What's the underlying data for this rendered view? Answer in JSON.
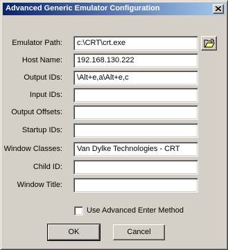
{
  "window": {
    "title": "Advanced Generic Emulator Configuration",
    "close_icon": "close-icon"
  },
  "form": {
    "fields": [
      {
        "label": "Emulator Path:",
        "value": "c:\\CRT\\crt.exe"
      },
      {
        "label": "Host Name:",
        "value": "192.168.130.222"
      },
      {
        "label": "Output IDs:",
        "value": "\\Alt+e,a\\Alt+e,c"
      },
      {
        "label": "Input IDs:",
        "value": ""
      },
      {
        "label": "Output Offsets:",
        "value": ""
      },
      {
        "label": "Startup IDs:",
        "value": ""
      },
      {
        "label": "Window Classes:",
        "value": "Van Dylke Technologies - CRT"
      },
      {
        "label": "Child ID:",
        "value": ""
      },
      {
        "label": "Window Title:",
        "value": ""
      }
    ],
    "browse_icon": "folder-open-icon",
    "advanced_enter_label": "Use Advanced Enter Method",
    "advanced_enter_checked": false
  },
  "buttons": {
    "ok_label": "OK",
    "cancel_label": "Cancel"
  }
}
